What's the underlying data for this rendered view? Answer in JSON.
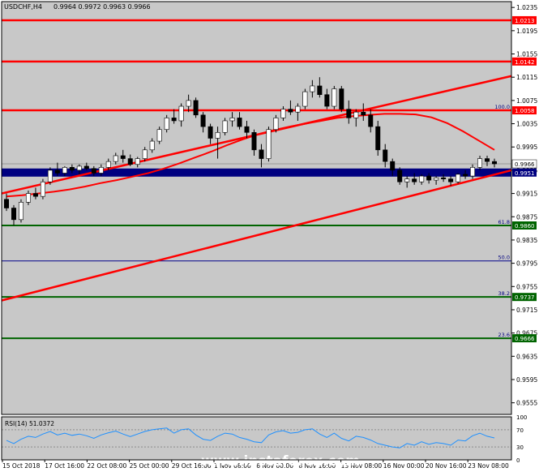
{
  "header": {
    "symbol": "USDCHF,H4",
    "ohlc": "0.9964 0.9972 0.9963 0.9966"
  },
  "watermark": "www.instaforex.com",
  "colors": {
    "background": "#c8c8c8",
    "candle_up": "#ffffff",
    "candle_down": "#000000",
    "trendline": "#ff0000",
    "resistance": "#ff0000",
    "fib_green": "#006400",
    "fib_navy": "#00008b",
    "zone": "#000080",
    "rsi_line": "#1e90ff"
  },
  "chart_data": {
    "type": "candlestick",
    "title": "USDCHF,H4",
    "ylim": [
      0.9535,
      1.0245
    ],
    "y_ticks": [
      "1.0235",
      "1.0195",
      "1.0155",
      "1.0115",
      "1.0075",
      "1.0035",
      "0.9995",
      "0.9955",
      "0.9915",
      "0.9875",
      "0.9835",
      "0.9795",
      "0.9755",
      "0.9715",
      "0.9675",
      "0.9635",
      "0.9595",
      "0.9555"
    ],
    "x_ticks": [
      "15 Oct 2018",
      "17 Oct 16:00",
      "22 Oct 08:00",
      "25 Oct 00:00",
      "29 Oct 16:00",
      "1 Nov 08:00",
      "6 Nov 00:00",
      "8 Nov 16:00",
      "13 Nov 08:00",
      "16 Nov 00:00",
      "20 Nov 16:00",
      "23 Nov 08:00"
    ],
    "price_labels": [
      "1.0213",
      "1.0142",
      "1.0058",
      "0.9966",
      "0.9951",
      "0.9860",
      "0.9737",
      "0.9666"
    ],
    "horizontal_levels": [
      {
        "value": 1.0213,
        "color": "#ff0000",
        "label": "1.0213"
      },
      {
        "value": 1.0142,
        "color": "#ff0000",
        "label": "1.0142"
      },
      {
        "value": 1.0058,
        "color": "#ff0000",
        "label": "1.0058",
        "fib": "100.0"
      },
      {
        "value": 0.986,
        "color": "#006400",
        "label": "0.9860",
        "fib": "61.8"
      },
      {
        "value": 0.9799,
        "color": "#00008b",
        "label": "",
        "fib": "50.0"
      },
      {
        "value": 0.9737,
        "color": "#006400",
        "label": "0.9737",
        "fib": "38.2"
      },
      {
        "value": 0.9666,
        "color": "#006400",
        "label": "0.9666",
        "fib": "23.6"
      }
    ],
    "fib_labels": [
      "100.0",
      "61.8",
      "50.0",
      "38.2",
      "23.6"
    ],
    "zone": {
      "from": 0.9944,
      "to": 0.9958,
      "label": "0.9951"
    },
    "current_price": "0.9966",
    "trendlines": [
      {
        "x": [
          0.0,
          1.0
        ],
        "y": [
          0.9915,
          1.0117
        ]
      },
      {
        "x": [
          0.0,
          1.0
        ],
        "y": [
          0.9731,
          0.9955
        ]
      }
    ],
    "moving_average": [
      0.991,
      0.9912,
      0.9915,
      0.9918,
      0.9922,
      0.9927,
      0.9933,
      0.9938,
      0.9944,
      0.995,
      0.9958,
      0.9967,
      0.9977,
      0.9987,
      0.9998,
      1.0008,
      1.0017,
      1.0024,
      1.003,
      1.0035,
      1.004,
      1.0045,
      1.0048,
      1.005,
      1.0052,
      1.0052,
      1.0051,
      1.0046,
      1.0036,
      1.0022,
      1.0006,
      0.999
    ],
    "ohlc": [
      [
        0.9905,
        0.9915,
        0.9885,
        0.989
      ],
      [
        0.989,
        0.9895,
        0.986,
        0.987
      ],
      [
        0.987,
        0.9905,
        0.9865,
        0.99
      ],
      [
        0.99,
        0.992,
        0.9895,
        0.9915
      ],
      [
        0.9915,
        0.9925,
        0.9905,
        0.991
      ],
      [
        0.991,
        0.994,
        0.9905,
        0.9935
      ],
      [
        0.9935,
        0.996,
        0.993,
        0.9955
      ],
      [
        0.9955,
        0.9968,
        0.9945,
        0.995
      ],
      [
        0.995,
        0.9962,
        0.9945,
        0.996
      ],
      [
        0.996,
        0.9965,
        0.995,
        0.9955
      ],
      [
        0.9955,
        0.9965,
        0.9948,
        0.9962
      ],
      [
        0.9962,
        0.9968,
        0.9955,
        0.9958
      ],
      [
        0.9958,
        0.9962,
        0.9945,
        0.995
      ],
      [
        0.995,
        0.9965,
        0.9945,
        0.996
      ],
      [
        0.996,
        0.9975,
        0.9955,
        0.997
      ],
      [
        0.997,
        0.9985,
        0.9965,
        0.998
      ],
      [
        0.998,
        0.999,
        0.9968,
        0.9975
      ],
      [
        0.9975,
        0.9982,
        0.9962,
        0.9965
      ],
      [
        0.9965,
        0.9978,
        0.996,
        0.9975
      ],
      [
        0.9975,
        0.9995,
        0.997,
        0.999
      ],
      [
        0.999,
        1.001,
        0.9985,
        1.0005
      ],
      [
        1.0005,
        1.003,
        1.0,
        1.0025
      ],
      [
        1.0025,
        1.005,
        1.002,
        1.0045
      ],
      [
        1.0045,
        1.006,
        1.0035,
        1.004
      ],
      [
        1.004,
        1.007,
        1.003,
        1.0065
      ],
      [
        1.0065,
        1.0085,
        1.0055,
        1.0075
      ],
      [
        1.0075,
        1.008,
        1.0045,
        1.005
      ],
      [
        1.005,
        1.0055,
        1.002,
        1.003
      ],
      [
        1.003,
        1.0035,
        1.0,
        1.001
      ],
      [
        1.001,
        1.003,
        0.9975,
        1.002
      ],
      [
        1.002,
        1.0045,
        1.0015,
        1.004
      ],
      [
        1.004,
        1.0055,
        1.003,
        1.0045
      ],
      [
        1.0045,
        1.0055,
        1.0025,
        1.003
      ],
      [
        1.003,
        1.004,
        1.001,
        1.002
      ],
      [
        1.002,
        1.0025,
        0.998,
        0.999
      ],
      [
        0.999,
        1.0,
        0.996,
        0.9975
      ],
      [
        0.9975,
        1.003,
        0.997,
        1.0025
      ],
      [
        1.0025,
        1.005,
        1.002,
        1.0045
      ],
      [
        1.0045,
        1.0065,
        1.004,
        1.006
      ],
      [
        1.006,
        1.0075,
        1.005,
        1.0055
      ],
      [
        1.0055,
        1.007,
        1.004,
        1.0065
      ],
      [
        1.0065,
        1.0095,
        1.006,
        1.009
      ],
      [
        1.009,
        1.011,
        1.008,
        1.01
      ],
      [
        1.01,
        1.0115,
        1.008,
        1.0085
      ],
      [
        1.0085,
        1.0095,
        1.006,
        1.0065
      ],
      [
        1.0065,
        1.01,
        1.006,
        1.0095
      ],
      [
        1.0095,
        1.01,
        1.0055,
        1.006
      ],
      [
        1.006,
        1.0075,
        1.0035,
        1.0045
      ],
      [
        1.0045,
        1.006,
        1.003,
        1.0055
      ],
      [
        1.0055,
        1.007,
        1.004,
        1.005
      ],
      [
        1.005,
        1.006,
        1.002,
        1.003
      ],
      [
        1.003,
        1.004,
        0.998,
        0.999
      ],
      [
        0.999,
        1.0,
        0.996,
        0.997
      ],
      [
        0.997,
        0.9975,
        0.9945,
        0.9955
      ],
      [
        0.9955,
        0.996,
        0.993,
        0.9935
      ],
      [
        0.9935,
        0.9945,
        0.9925,
        0.994
      ],
      [
        0.994,
        0.995,
        0.993,
        0.9935
      ],
      [
        0.9935,
        0.9948,
        0.993,
        0.9945
      ],
      [
        0.9945,
        0.995,
        0.9932,
        0.9938
      ],
      [
        0.9938,
        0.9945,
        0.993,
        0.9942
      ],
      [
        0.9942,
        0.9948,
        0.9935,
        0.994
      ],
      [
        0.994,
        0.9945,
        0.9928,
        0.9935
      ],
      [
        0.9935,
        0.995,
        0.9932,
        0.9948
      ],
      [
        0.9948,
        0.9955,
        0.994,
        0.9945
      ],
      [
        0.9945,
        0.9965,
        0.994,
        0.996
      ],
      [
        0.996,
        0.998,
        0.9955,
        0.9975
      ],
      [
        0.9975,
        0.998,
        0.9962,
        0.997
      ],
      [
        0.997,
        0.9975,
        0.996,
        0.9966
      ]
    ]
  },
  "rsi": {
    "label": "RSI(14) 51.0372",
    "ylim": [
      0,
      100
    ],
    "levels": [
      70,
      30
    ],
    "tick_labels": [
      "100",
      "70",
      "30",
      "0"
    ],
    "values": [
      45,
      38,
      48,
      55,
      52,
      60,
      66,
      58,
      62,
      57,
      60,
      56,
      50,
      58,
      63,
      67,
      60,
      54,
      60,
      66,
      70,
      72,
      74,
      62,
      70,
      72,
      58,
      48,
      45,
      55,
      62,
      60,
      52,
      48,
      42,
      40,
      58,
      65,
      68,
      62,
      64,
      70,
      72,
      60,
      52,
      62,
      50,
      44,
      55,
      52,
      46,
      38,
      34,
      30,
      28,
      38,
      34,
      42,
      36,
      40,
      38,
      34,
      46,
      44,
      56,
      62,
      55,
      51
    ]
  }
}
